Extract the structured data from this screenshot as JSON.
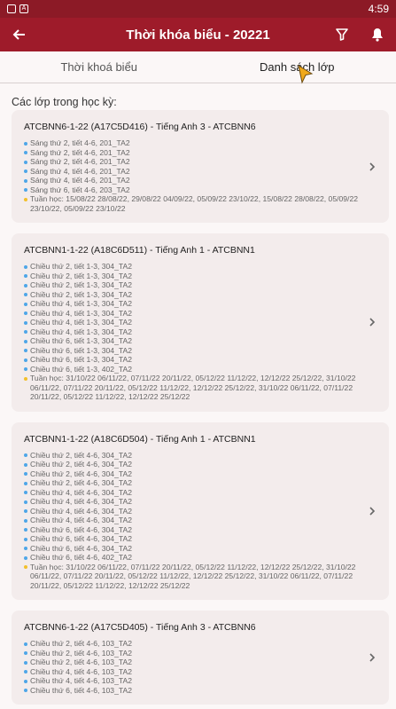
{
  "status_bar": {
    "time": "4:59",
    "icons": [
      "shield-icon",
      "a-icon"
    ]
  },
  "app_bar": {
    "title": "Thời khóa biểu - 20221",
    "icons": [
      "arrow-back-icon",
      "filter-icon",
      "bell-icon"
    ]
  },
  "tabs": [
    {
      "label": "Thời khoá biểu",
      "active": false
    },
    {
      "label": "Danh sách lớp",
      "active": true
    }
  ],
  "section_label": "Các lớp trong học kỳ:",
  "classes": [
    {
      "title": "ATCBNN6-1-22 (A17C5D416) - Tiếng Anh 3 - ATCBNN6",
      "sessions": [
        "Sáng thứ 2, tiết 4-6, 201_TA2",
        "Sáng thứ 2, tiết 4-6, 201_TA2",
        "Sáng thứ 2, tiết 4-6, 201_TA2",
        "Sáng thứ 4, tiết 4-6, 201_TA2",
        "Sáng thứ 4, tiết 4-6, 201_TA2",
        "Sáng thứ 6, tiết 4-6, 203_TA2"
      ],
      "weeks": "Tuần học: 15/08/22 28/08/22, 29/08/22 04/09/22, 05/09/22 23/10/22, 15/08/22 28/08/22, 05/09/22 23/10/22, 05/09/22 23/10/22"
    },
    {
      "title": "ATCBNN1-1-22 (A18C6D511) - Tiếng Anh 1 - ATCBNN1",
      "sessions": [
        "Chiều thứ 2, tiết 1-3, 304_TA2",
        "Chiều thứ 2, tiết 1-3, 304_TA2",
        "Chiều thứ 2, tiết 1-3, 304_TA2",
        "Chiều thứ 2, tiết 1-3, 304_TA2",
        "Chiều thứ 4, tiết 1-3, 304_TA2",
        "Chiều thứ 4, tiết 1-3, 304_TA2",
        "Chiều thứ 4, tiết 1-3, 304_TA2",
        "Chiều thứ 4, tiết 1-3, 304_TA2",
        "Chiều thứ 6, tiết 1-3, 304_TA2",
        "Chiều thứ 6, tiết 1-3, 304_TA2",
        "Chiều thứ 6, tiết 1-3, 304_TA2",
        "Chiều thứ 6, tiết 1-3, 402_TA2"
      ],
      "weeks": "Tuần học: 31/10/22 06/11/22, 07/11/22 20/11/22, 05/12/22 11/12/22, 12/12/22 25/12/22, 31/10/22 06/11/22, 07/11/22 20/11/22, 05/12/22 11/12/22, 12/12/22 25/12/22, 31/10/22 06/11/22, 07/11/22 20/11/22, 05/12/22 11/12/22, 12/12/22 25/12/22"
    },
    {
      "title": "ATCBNN1-1-22 (A18C6D504) - Tiếng Anh 1 - ATCBNN1",
      "sessions": [
        "Chiều thứ 2, tiết 4-6, 304_TA2",
        "Chiều thứ 2, tiết 4-6, 304_TA2",
        "Chiều thứ 2, tiết 4-6, 304_TA2",
        "Chiều thứ 2, tiết 4-6, 304_TA2",
        "Chiều thứ 4, tiết 4-6, 304_TA2",
        "Chiều thứ 4, tiết 4-6, 304_TA2",
        "Chiều thứ 4, tiết 4-6, 304_TA2",
        "Chiều thứ 4, tiết 4-6, 304_TA2",
        "Chiều thứ 6, tiết 4-6, 304_TA2",
        "Chiều thứ 6, tiết 4-6, 304_TA2",
        "Chiều thứ 6, tiết 4-6, 304_TA2",
        "Chiều thứ 6, tiết 4-6, 402_TA2"
      ],
      "weeks": "Tuần học: 31/10/22 06/11/22, 07/11/22 20/11/22, 05/12/22 11/12/22, 12/12/22 25/12/22, 31/10/22 06/11/22, 07/11/22 20/11/22, 05/12/22 11/12/22, 12/12/22 25/12/22, 31/10/22 06/11/22, 07/11/22 20/11/22, 05/12/22 11/12/22, 12/12/22 25/12/22"
    },
    {
      "title": "ATCBNN6-1-22 (A17C5D405) - Tiếng Anh 3 - ATCBNN6",
      "sessions": [
        "Chiều thứ 2, tiết 4-6, 103_TA2",
        "Chiều thứ 2, tiết 4-6, 103_TA2",
        "Chiều thứ 2, tiết 4-6, 103_TA2",
        "Chiều thứ 4, tiết 4-6, 103_TA2",
        "Chiều thứ 4, tiết 4-6, 103_TA2",
        "Chiều thứ 6, tiết 4-6, 103_TA2"
      ],
      "weeks": ""
    }
  ],
  "colors": {
    "app_bar": "#9e1b2a",
    "status_bar": "#8c1a26",
    "card_bg": "#f3ecec",
    "session_dot": "#4ea6e8",
    "weeks_dot": "#f2c02b"
  }
}
